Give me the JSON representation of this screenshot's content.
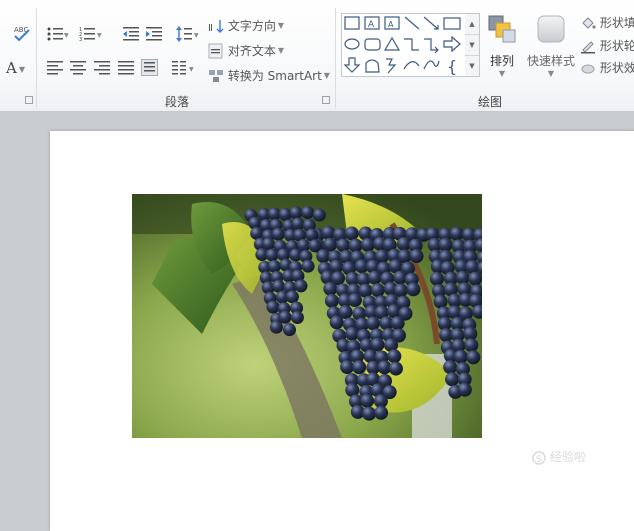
{
  "ribbon": {
    "paragraph_group": {
      "label": "段落",
      "text_direction": "文字方向",
      "align_text": "对齐文本",
      "convert_smartart": "转换为 SmartArt"
    },
    "drawing_group": {
      "label": "绘图",
      "arrange": "排列",
      "quick_styles": "快速样式",
      "shape_fill": "形状填",
      "shape_outline": "形状轮",
      "shape_effects": "形状效"
    },
    "font_color_letter": "A"
  },
  "watermark": "经验啦"
}
